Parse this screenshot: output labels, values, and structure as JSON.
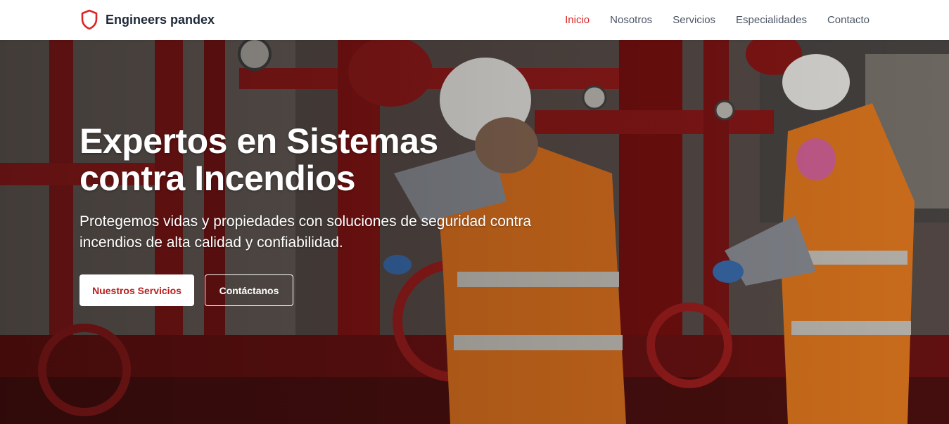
{
  "brand": {
    "name": "Engineers pandex",
    "icon": "shield-icon",
    "accent": "#dc2626"
  },
  "nav": {
    "items": [
      {
        "label": "Inicio",
        "active": true
      },
      {
        "label": "Nosotros",
        "active": false
      },
      {
        "label": "Servicios",
        "active": false
      },
      {
        "label": "Especialidades",
        "active": false
      },
      {
        "label": "Contacto",
        "active": false
      }
    ]
  },
  "hero": {
    "title": "Expertos en Sistemas contra Incendios",
    "subtitle": "Protegemos vidas y propiedades con soluciones de seguridad contra incendios de alta calidad y confiabilidad.",
    "primary_button": "Nuestros Servicios",
    "secondary_button": "Contáctanos",
    "image_subject": "technicians-servicing-red-fire-pump-valves"
  }
}
